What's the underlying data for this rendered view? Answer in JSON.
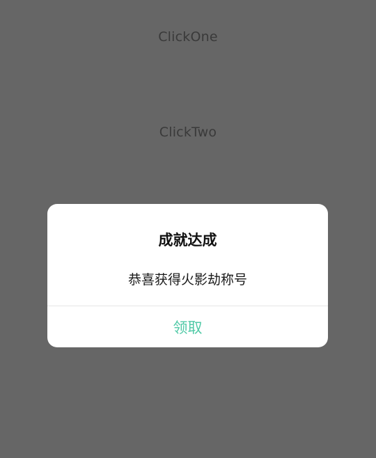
{
  "background": {
    "button_one_label": "ClickOne",
    "button_two_label": "ClickTwo"
  },
  "dialog": {
    "title": "成就达成",
    "message": "恭喜获得火影劫称号",
    "confirm_label": "领取",
    "accent_color": "#4fc9a6"
  },
  "colors": {
    "scrim": "#666666",
    "dialog_bg": "#ffffff"
  }
}
